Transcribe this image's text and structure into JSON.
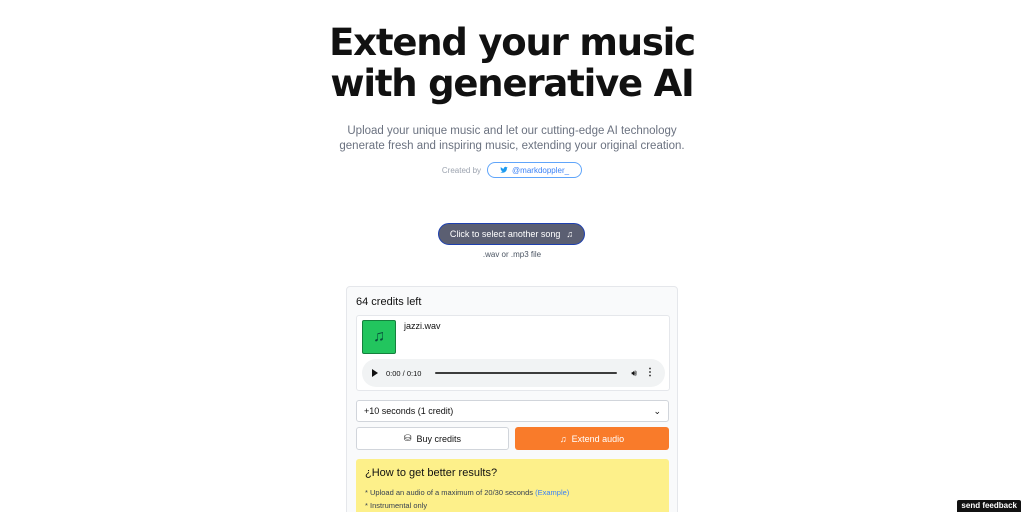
{
  "hero": {
    "title_line1": "Extend your music",
    "title_line2": "with generative AI",
    "subtitle": "Upload your unique music and let our cutting-edge AI technology generate fresh and inspiring music, extending your original creation.",
    "created_by": "Created by",
    "twitter_handle": "@markdoppler_"
  },
  "upload": {
    "button_label": "Click to select another song",
    "music_glyph": "♫",
    "hint": ".wav or .mp3 file"
  },
  "panel": {
    "credits_left": "64 credits left",
    "file_name": "jazzi.wav",
    "thumb_glyph": "♫",
    "player_time": "0:00 / 0:10",
    "player_progress": 0.0,
    "duration_option": "+10 seconds (1 credit)",
    "buy_label": "Buy credits",
    "extend_label": "Extend audio",
    "tips_title": "¿How to get better results?",
    "tips": [
      {
        "text": "* Upload an audio of a maximum of 20/30 seconds",
        "link": "(Example)"
      },
      {
        "text": "* Instrumental only",
        "link": ""
      }
    ]
  },
  "feedback_label": "send feedback",
  "colors": {
    "extend_button": "#f97b2a",
    "upload_button": "#5b5f72",
    "tips_background": "#fdf08a",
    "thumb": "#22c55e",
    "link": "#3b82f6"
  },
  "icons": [
    "twitter-icon",
    "music-note-icon",
    "play-icon",
    "volume-icon",
    "more-vertical-icon",
    "chevron-down-icon",
    "coins-icon",
    "music-extend-icon"
  ]
}
